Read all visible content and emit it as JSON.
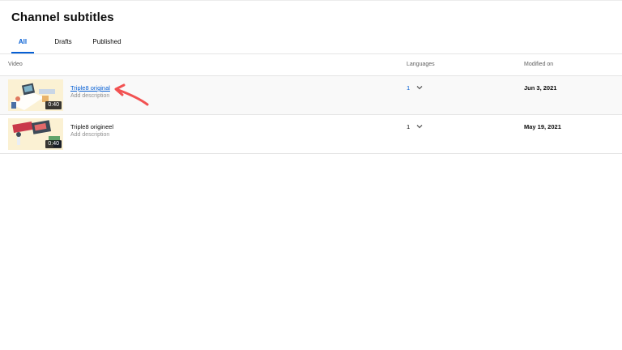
{
  "page": {
    "title": "Channel subtitles"
  },
  "tabs": [
    {
      "label": "All",
      "active": true
    },
    {
      "label": "Drafts",
      "active": false
    },
    {
      "label": "Published",
      "active": false
    }
  ],
  "table": {
    "columns": {
      "video": "Video",
      "languages": "Languages",
      "modified": "Modified on"
    },
    "rows": [
      {
        "title": "Triple8 original",
        "description": "Add description",
        "duration": "0:40",
        "languages": "1",
        "modified": "Jun 3, 2021",
        "title_is_link": true
      },
      {
        "title": "Triple8 origineel",
        "description": "Add description",
        "duration": "0:40",
        "languages": "1",
        "modified": "May 19, 2021",
        "title_is_link": false
      }
    ]
  },
  "colors": {
    "accent": "#065fd4",
    "annotation_arrow": "#f25252",
    "thumb_bg": "#fbf1d3"
  },
  "icons": {
    "dropdown": "chevron-down-icon",
    "annotation": "red-arrow-annotation"
  }
}
